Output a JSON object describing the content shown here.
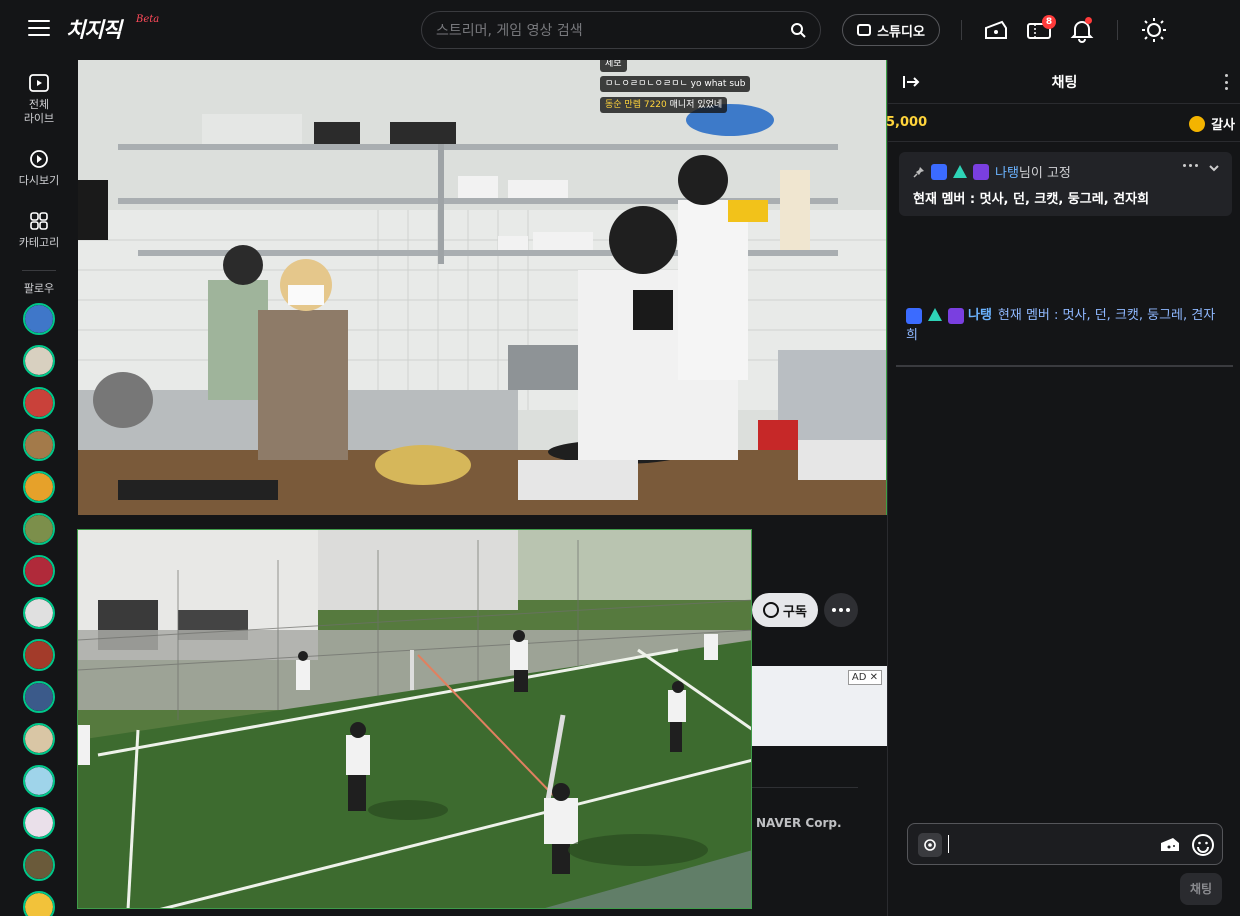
{
  "header": {
    "logo_text": "치지직",
    "logo_beta": "Beta",
    "search_placeholder": "스트리머, 게임 영상 검색",
    "studio_label": "스튜디오",
    "ticket_badge": "8"
  },
  "leftnav": {
    "items": [
      {
        "label_line1": "전체",
        "label_line2": "라이브"
      },
      {
        "label_line1": "다시보기",
        "label_line2": ""
      },
      {
        "label_line1": "카테고리",
        "label_line2": ""
      }
    ],
    "follow_label": "팔로우"
  },
  "video_overlay": {
    "line1": "제보",
    "line2": "ㅁㄴㅇㄹㅁㄴㅇㄹㅁㄴ yo what sub",
    "line3_prefix": "동순 만렙 7220",
    "line3_suffix": "매니저 있었네"
  },
  "channel": {
    "subscribe_label": "구독",
    "ad_label": "AD",
    "footer_company": "NAVER Corp."
  },
  "chat": {
    "title": "채팅",
    "donation_amount": "5,000",
    "donation_user": "갈사",
    "pinned_by": "나탱",
    "pinned_suffix": "님이 고정",
    "pinned_message": "현재 멤버 : 멋사, 던, 크캣, 둥그레, 견자희",
    "message": {
      "user": "나탱",
      "text": "현재 멤버 : 멋사, 던, 크캣, 둥그레, 견자희"
    },
    "send_label": "채팅"
  },
  "colors": {
    "accent_green": "#00c78a",
    "badge_red": "#ff3b3b",
    "donation_yellow": "#ffd43b",
    "username_blue": "#6bb3ff"
  }
}
